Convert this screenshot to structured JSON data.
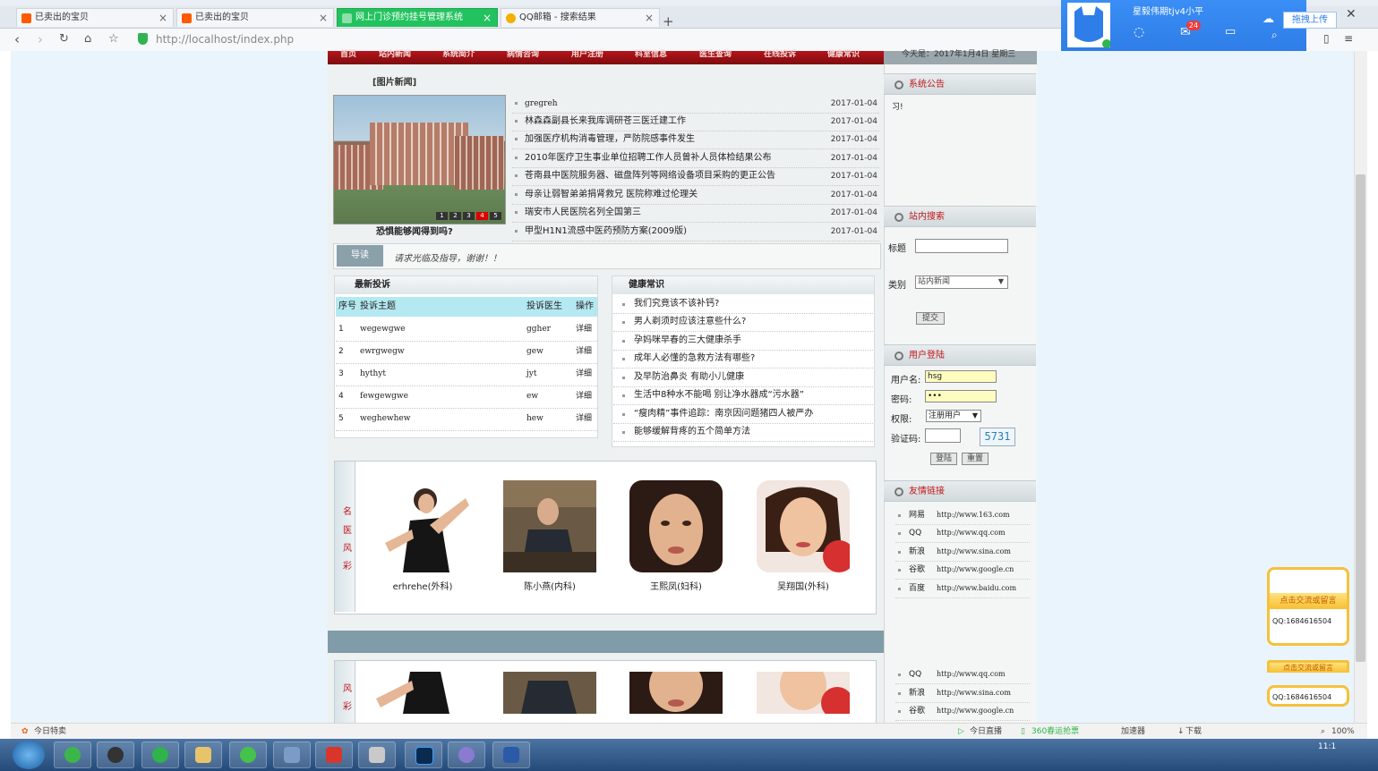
{
  "browser": {
    "tabs": [
      {
        "label": "已卖出的宝贝",
        "icon": "taobao-icon",
        "active": false
      },
      {
        "label": "已卖出的宝贝",
        "icon": "taobao-icon",
        "active": false
      },
      {
        "label": "网上门诊预约挂号管理系统",
        "icon": "page-icon",
        "active": true
      },
      {
        "label": "QQ邮箱 - 搜索结果",
        "icon": "qq-icon",
        "active": false
      }
    ],
    "new_tab": "+",
    "url": "http://localhost/index.php"
  },
  "qq_popup": {
    "name": "星毅伟期tjv4小平",
    "mail_count": "24",
    "upload_label": "拖拽上传"
  },
  "site": {
    "nav": [
      "首页",
      "站内新闻",
      "系统简介",
      "病情咨询",
      "用户注册",
      "科室信息",
      "医生查询",
      "在线投诉",
      "健康常识"
    ],
    "date_text": "今天是：2017年1月4日 星期三",
    "photo_news": {
      "title": "[图片新闻]",
      "caption": "恐惧能够闻得到吗?",
      "pager": [
        "1",
        "2",
        "3",
        "4",
        "5"
      ],
      "active_page": "4"
    },
    "news": [
      {
        "title": "gregreh",
        "date": "2017-01-04"
      },
      {
        "title": "林森森副县长来我库调研苍三医迁建工作",
        "date": "2017-01-04"
      },
      {
        "title": "加强医疗机构消毒管理，严防院感事件发生",
        "date": "2017-01-04"
      },
      {
        "title": "2010年医疗卫生事业单位招聘工作人员曾补人员体检结果公布",
        "date": "2017-01-04"
      },
      {
        "title": "苍南县中医院服务器、磁盘阵列等网络设备项目采购的更正公告",
        "date": "2017-01-04"
      },
      {
        "title": "母亲让弱智弟弟捐肾救兄 医院称难过伦理关",
        "date": "2017-01-04"
      },
      {
        "title": "瑞安市人民医院名列全国第三",
        "date": "2017-01-04"
      },
      {
        "title": "甲型H1N1流感中医药预防方案(2009版)",
        "date": "2017-01-04"
      }
    ],
    "guide": {
      "tag": "导读",
      "text": "请求光临及指导，谢谢！！"
    },
    "complaints": {
      "title": "最新投诉",
      "headers": [
        "序号",
        "投诉主题",
        "投诉医生",
        "操作"
      ],
      "rows": [
        [
          "1",
          "wegewgwe",
          "ggher",
          "详细"
        ],
        [
          "2",
          "ewrgwegw",
          "gew",
          "详细"
        ],
        [
          "3",
          "hythyt",
          "jyt",
          "详细"
        ],
        [
          "4",
          "fewgewgwe",
          "ew",
          "详细"
        ],
        [
          "5",
          "weghewhew",
          "hew",
          "详细"
        ]
      ]
    },
    "health": {
      "title": "健康常识",
      "items": [
        "我们究竟该不该补钙?",
        "男人剃须时应该注意些什么?",
        "孕妈咪早春的三大健康杀手",
        "成年人必懂的急救方法有哪些?",
        "及早防治鼻炎 有助小儿健康",
        "生活中8种水不能喝 别让净水器成“污水器”",
        "“瘦肉精”事件追踪：南京因问题猪四人被严办",
        "能够缓解背疼的五个简单方法"
      ]
    },
    "doctors": {
      "side_label": [
        "名",
        "医",
        "风",
        "彩"
      ],
      "list": [
        {
          "name": "erhrehe(外科)"
        },
        {
          "name": "陈小燕(内科)"
        },
        {
          "name": "王熙凤(妇科)"
        },
        {
          "name": "吴翔国(外科)"
        }
      ],
      "side_label_2": [
        "风",
        "彩"
      ]
    },
    "sidebar": {
      "notice": {
        "title": "系统公告",
        "text": "习!"
      },
      "search": {
        "title": "站内搜索",
        "title_label": "标题",
        "category_label": "类别",
        "category_value": "站内新闻",
        "submit": "提交"
      },
      "login": {
        "title": "用户登陆",
        "username_label": "用户名:",
        "username_value": "hsg",
        "password_label": "密码:",
        "password_value": "•••",
        "role_label": "权限:",
        "role_value": "注册用户",
        "captcha_label": "验证码:",
        "captcha_code": "5731",
        "login_btn": "登陆",
        "reset_btn": "重置"
      },
      "links": {
        "title": "友情链接",
        "items": [
          {
            "name": "网易",
            "url": "http://www.163.com"
          },
          {
            "name": "QQ",
            "url": "http://www.qq.com"
          },
          {
            "name": "新浪",
            "url": "http://www.sina.com"
          },
          {
            "name": "谷歌",
            "url": "http://www.google.cn"
          },
          {
            "name": "百度",
            "url": "http://www.baidu.com"
          }
        ],
        "items_2": [
          {
            "name": "QQ",
            "url": "http://www.qq.com"
          },
          {
            "name": "新浪",
            "url": "http://www.sina.com"
          },
          {
            "name": "谷歌",
            "url": "http://www.google.cn"
          }
        ]
      }
    },
    "float_contact": {
      "head": "点击交流或留言",
      "qq": "QQ:1684616504"
    }
  },
  "statusbar": {
    "left": "今日特卖",
    "items": [
      "今日直播",
      "360春运抢票",
      "加速器",
      "下载",
      "100%"
    ]
  },
  "taskbar": {
    "time": "11:1"
  }
}
